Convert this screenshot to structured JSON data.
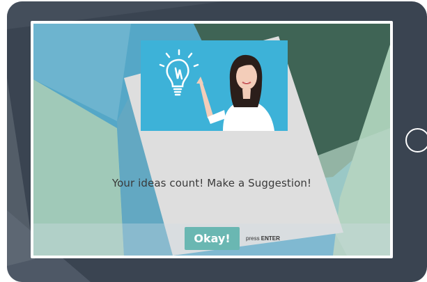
{
  "screen": {
    "message": "Your ideas count! Make a Suggestion!",
    "okay_label": "Okay!",
    "press_label": "press",
    "key_label": "ENTER"
  },
  "colors": {
    "tablet_frame": "#3a4451",
    "background_blue": "#55a7c7",
    "background_dark_green": "#3f6455",
    "background_mint": "#a8cdb6",
    "card": "#dedede",
    "button": "#6ab7b2"
  },
  "icons": {
    "hero": "lightbulb-idea-icon",
    "home": "home-button-icon"
  }
}
